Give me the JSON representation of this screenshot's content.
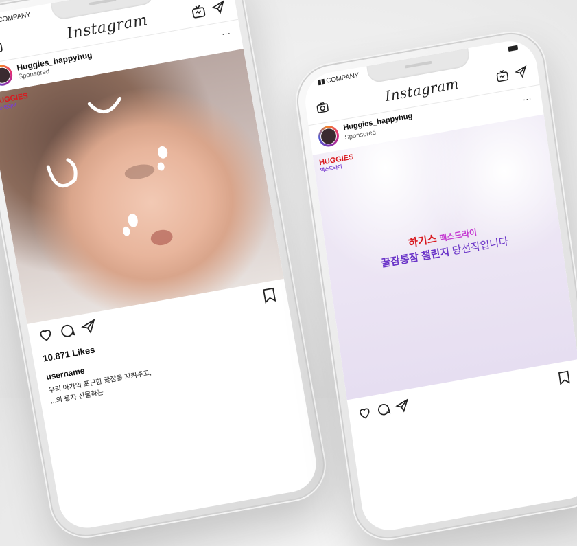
{
  "phone_left": {
    "carrier": "COMPANY",
    "app_title": "Instagram",
    "post": {
      "username": "Huggies_happyhug",
      "sponsored": "Sponsored",
      "more": "...",
      "brand_logo": "HUGGIES",
      "brand_sub": "맥스드라이",
      "likes": "10.871 Likes",
      "caption_user": "username",
      "caption_line1": "우리 아가의 포근한 꿀잠을 지켜주고,",
      "caption_line2": "...의 동자 선물하는"
    }
  },
  "phone_right": {
    "carrier": "COMPANY",
    "app_title": "Instagram",
    "post": {
      "username": "Huggies_happyhug",
      "sponsored": "Sponsored",
      "more": "...",
      "brand_logo": "HUGGIES",
      "brand_sub": "맥스드라이",
      "headline_brand": "하기스",
      "headline_product": "맥스드라이",
      "headline_line2_a": "꿀잠통잠 챌린지",
      "headline_line2_b": " 당선작입니다"
    }
  },
  "colors": {
    "huggies_red": "#d9191f",
    "purple": "#7b3fd1",
    "lavender_bg": "#efe9f6"
  },
  "icons": [
    "camera-icon",
    "igtv-icon",
    "direct-send-icon",
    "heart-icon",
    "comment-icon",
    "share-icon",
    "bookmark-icon"
  ]
}
